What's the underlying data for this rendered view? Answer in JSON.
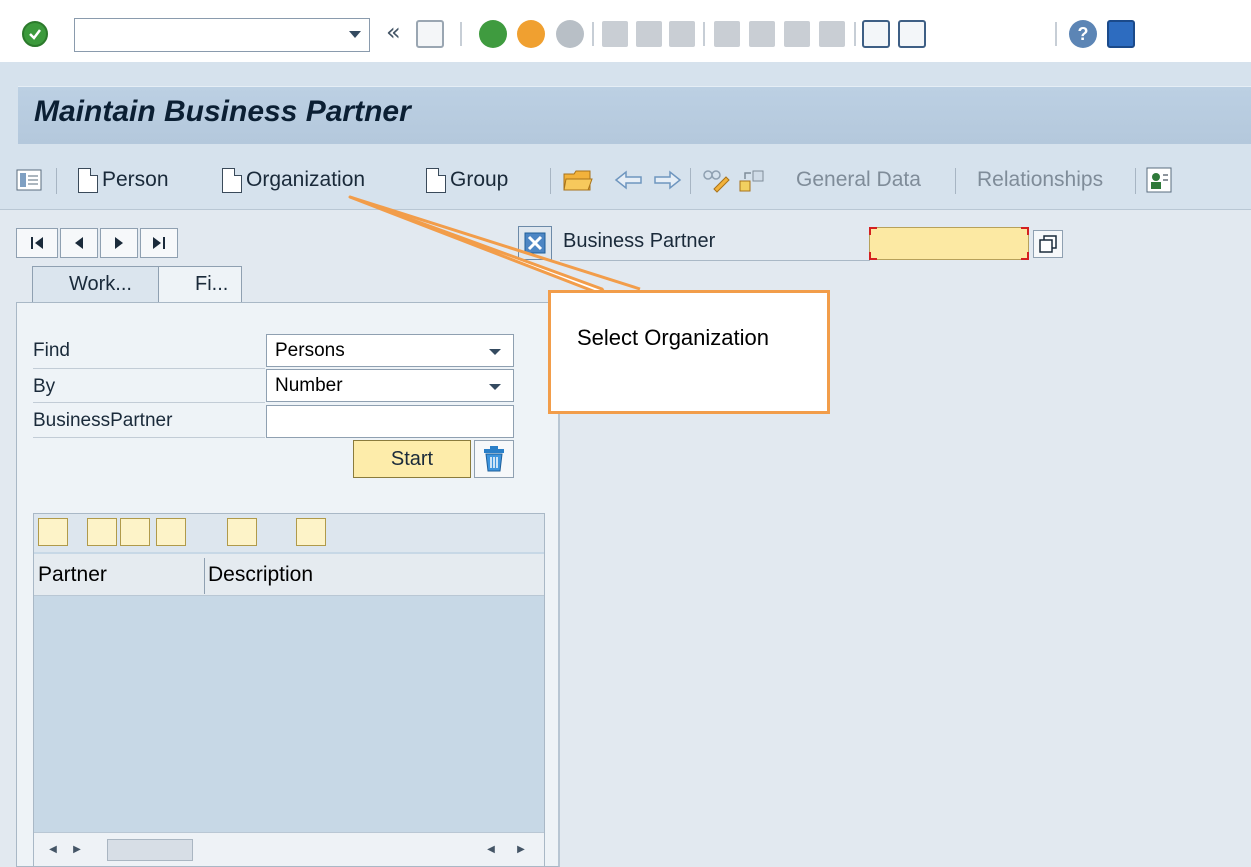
{
  "system_toolbar": {
    "command_field": {
      "value": "",
      "placeholder": ""
    },
    "collapse_glyph": "«",
    "help_glyph": "?"
  },
  "title": "Maintain Business Partner",
  "app_toolbar": {
    "person": "Person",
    "organization": "Organization",
    "group": "Group",
    "general_data": "General Data",
    "relationships": "Relationships"
  },
  "nav": {
    "first": "first-page-icon",
    "prev": "previous-page-icon",
    "next": "next-page-icon",
    "last": "last-page-icon"
  },
  "tabs": [
    {
      "label": "Work..."
    },
    {
      "label": "Fi..."
    }
  ],
  "find_panel": {
    "find_label": "Find",
    "find_value": "Persons",
    "by_label": "By",
    "by_value": "Number",
    "bp_label": "BusinessPartner",
    "bp_value": "",
    "start_label": "Start"
  },
  "result_list": {
    "columns": [
      "Partner",
      "Description"
    ],
    "rows": []
  },
  "business_partner": {
    "label": "Business Partner",
    "value": ""
  },
  "callout": {
    "text": "Select Organization",
    "border_color": "#f29d4a"
  },
  "colors": {
    "title_bg": "#bcd0e3",
    "toolbar_bg": "#d6e2ed",
    "required_field": "#fce9a3",
    "start_button": "#fdecaa"
  }
}
